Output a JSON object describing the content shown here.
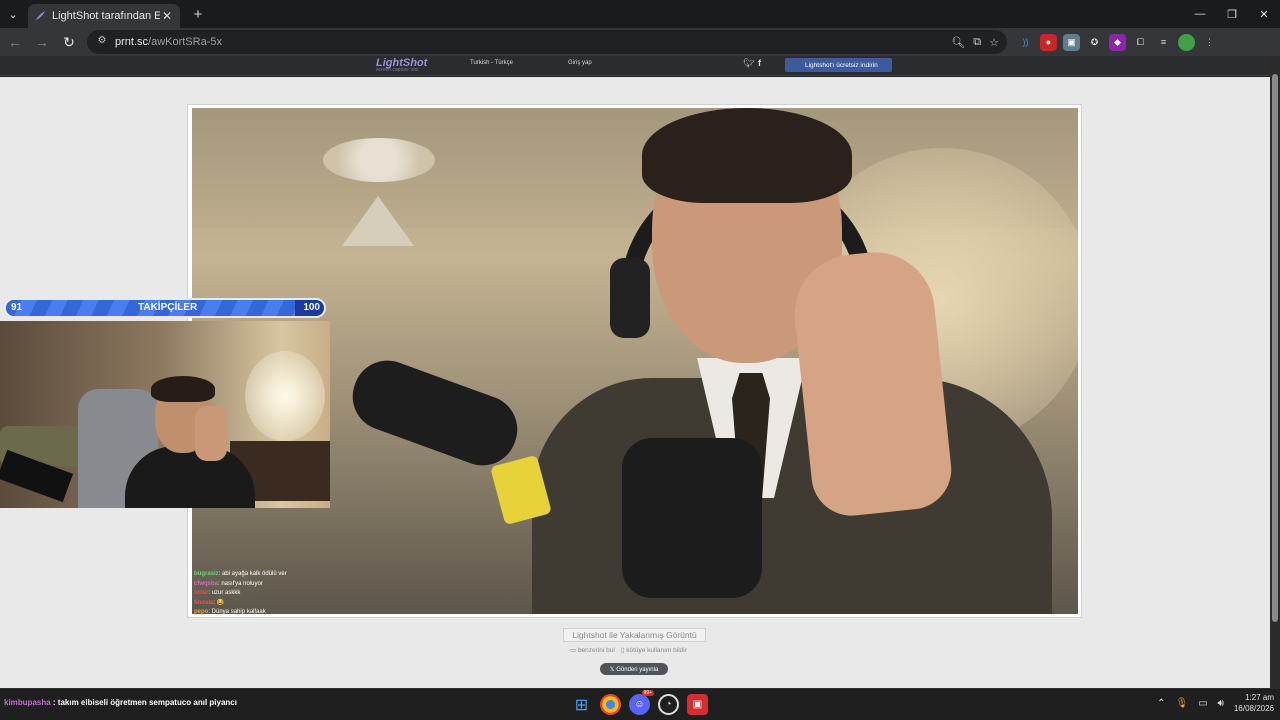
{
  "browser": {
    "tab_title": "LightShot tarafından Ekran Görü",
    "url_domain": "prnt.sc",
    "url_path": "/awKortSRa-5x",
    "new_tab": "+",
    "close": "✕"
  },
  "site": {
    "logo": "LightShot",
    "logo_tag": "screen capture tool",
    "language": "Turkish - Türkçe",
    "login": "Giriş yap",
    "download": "Lightshot'ı ücretsiz indirin",
    "caption": "Lightshot ile Yakalanmış Görüntü",
    "find_similar": "benzerini bul",
    "report": "kötüye kullanım bildir",
    "share": "𝕏 Gönderi yayınla"
  },
  "stream_chat": [
    {
      "user": "bugrasiz",
      "text": ": abi ayağa kalk ödülü ver",
      "color": "#6fd36f"
    },
    {
      "user": "cfwqsba",
      "text": ": nasıl'ya noluyor",
      "color": "#d36fc1"
    },
    {
      "user": "oclsr",
      "text": ": uzur askkk",
      "color": "#e05555"
    },
    {
      "user": "finosia",
      "text": ": 😂",
      "color": "#e05555"
    },
    {
      "user": "pepo",
      "text": ": Dünya sahip kalfaak",
      "color": "#e0a040"
    }
  ],
  "follower_goal": {
    "label": "TAKİPÇİLER",
    "current": "91",
    "target": "100",
    "progress": 0.91
  },
  "taskbar": {
    "ticker_user": "kimbupasha",
    "ticker_text": " : takım elbiseli öğretmen sempatuco anıl piyancı",
    "discord_badge": "99+",
    "time": "1:27 am",
    "date": "16/08/2026"
  }
}
